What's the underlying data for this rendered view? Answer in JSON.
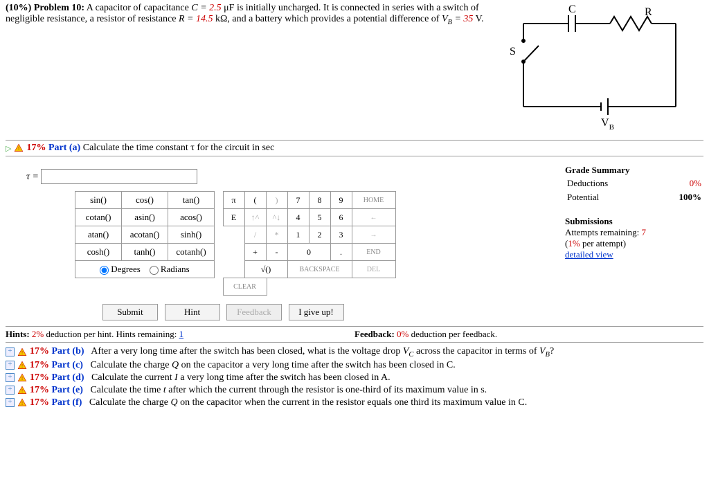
{
  "problem": {
    "prefix": "(10%)  Problem 10:",
    "text1": "   A capacitor of capacitance ",
    "c_eq": "C = ",
    "c_val": "2.5",
    "c_unit": " μF",
    "text2": " is initially uncharged. It is connected in series with a switch of negligible resistance, a resistor of resistance ",
    "r_eq": "R = ",
    "r_val": "14.5",
    "r_unit": " kΩ",
    "text3": ", and a battery which provides a potential difference of ",
    "v_eq": "V_B = ",
    "v_val": "35",
    "v_unit": " V",
    "text4": "."
  },
  "circuit": {
    "S": "S",
    "C": "C",
    "R": "R",
    "VB": "V",
    "B": "B"
  },
  "part_a": {
    "pct": "17% ",
    "label": "Part (a)",
    "text": "   Calculate the time constant τ for the circuit in sec"
  },
  "tau_label": "τ = ",
  "tau_value": "",
  "funcs": [
    [
      "sin()",
      "cos()",
      "tan()"
    ],
    [
      "cotan()",
      "asin()",
      "acos()"
    ],
    [
      "atan()",
      "acotan()",
      "sinh()"
    ],
    [
      "cosh()",
      "tanh()",
      "cotanh()"
    ]
  ],
  "deg": {
    "degrees": "Degrees",
    "radians": "Radians"
  },
  "nums": {
    "pi": "π",
    "lp": "(",
    "rp": ")",
    "n7": "7",
    "n8": "8",
    "n9": "9",
    "home": "HOME",
    "E": "E",
    "up1": "↑^",
    "up2": "^↓",
    "n4": "4",
    "n5": "5",
    "n6": "6",
    "left": "←",
    "sl": "/",
    "st": "*",
    "n1": "1",
    "n2": "2",
    "n3": "3",
    "right": "→",
    "pl": "+",
    "mn": "-",
    "n0": "0",
    "dot": ".",
    "end": "END",
    "sq": "√()",
    "bs": "BACKSPACE",
    "del": "DEL",
    "clr": "CLEAR"
  },
  "buttons": {
    "submit": "Submit",
    "hint": "Hint",
    "feedback": "Feedback",
    "giveup": "I give up!"
  },
  "grade": {
    "title": "Grade Summary",
    "ded_l": "Deductions",
    "ded_v": "0%",
    "pot_l": "Potential",
    "pot_v": "100%",
    "sub_t": "Submissions",
    "att_l": "Attempts remaining: ",
    "att_v": "7",
    "per": "(",
    "per_v": "1%",
    "per2": " per attempt)",
    "dv": "detailed view"
  },
  "hints": {
    "h_l": "Hints: ",
    "h_v": "2%",
    "h_t": " deduction per hint. Hints remaining: ",
    "h_r": "1",
    "f_l": "Feedback: ",
    "f_v": "0%",
    "f_t": " deduction per feedback."
  },
  "parts": [
    {
      "pct": "17% ",
      "label": "Part (b)",
      "text": "   After a very long time after the switch has been closed, what is the voltage drop V_C across the capacitor in terms of V_B?"
    },
    {
      "pct": "17% ",
      "label": "Part (c)",
      "text": "   Calculate the charge Q on the capacitor a very long time after the switch has been closed in C."
    },
    {
      "pct": "17% ",
      "label": "Part (d)",
      "text": "   Calculate the current I a very long time after the switch has been closed in A."
    },
    {
      "pct": "17% ",
      "label": "Part (e)",
      "text": "   Calculate the time t after which the current through the resistor is one-third of its maximum value in s."
    },
    {
      "pct": "17% ",
      "label": "Part (f)",
      "text": "   Calculate the charge Q on the capacitor when the current in the resistor equals one third its maximum value in C."
    }
  ]
}
